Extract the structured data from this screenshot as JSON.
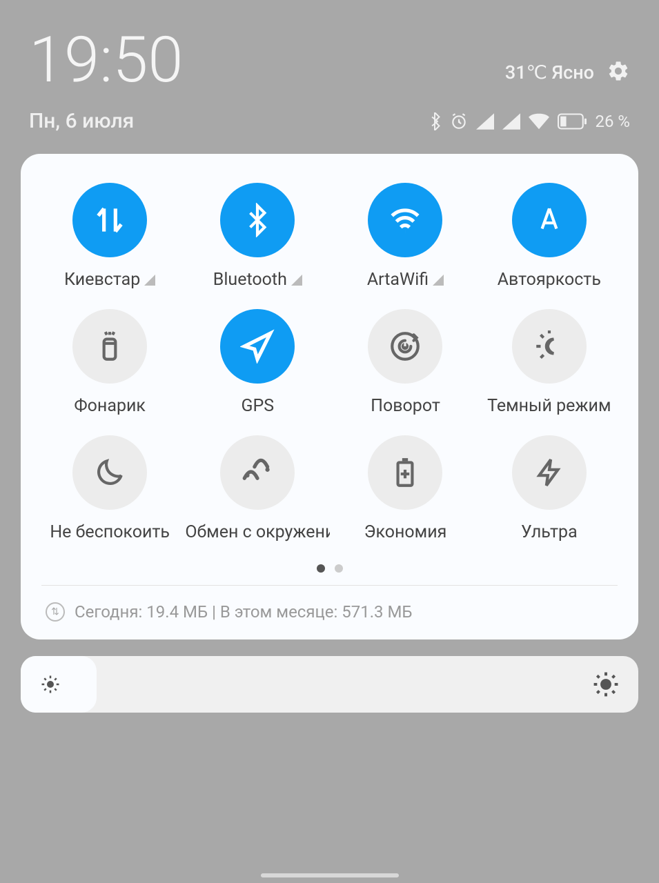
{
  "time": "19:50",
  "weather": "31℃ Ясно",
  "date": "Пн, 6 июля",
  "battery_percent": "26 %",
  "tiles": [
    {
      "label": "Киевстар",
      "on": true,
      "expandable": true,
      "icon": "data"
    },
    {
      "label": "Bluetooth",
      "on": true,
      "expandable": true,
      "icon": "bluetooth"
    },
    {
      "label": "ArtaWifi",
      "on": true,
      "expandable": true,
      "icon": "wifi"
    },
    {
      "label": "Автояркость",
      "on": true,
      "expandable": false,
      "icon": "autobright"
    },
    {
      "label": "Фонарик",
      "on": false,
      "expandable": false,
      "icon": "flashlight"
    },
    {
      "label": "GPS",
      "on": true,
      "expandable": false,
      "icon": "gps"
    },
    {
      "label": "Поворот",
      "on": false,
      "expandable": false,
      "icon": "rotate"
    },
    {
      "label": "Темный режим",
      "on": false,
      "expandable": false,
      "icon": "dark"
    },
    {
      "label": "Не беспокоить",
      "on": false,
      "expandable": false,
      "icon": "dnd"
    },
    {
      "label": "Обмен с окружением",
      "on": false,
      "expandable": false,
      "icon": "share"
    },
    {
      "label": "Экономия",
      "on": false,
      "expandable": false,
      "icon": "battery"
    },
    {
      "label": "Ультра",
      "on": false,
      "expandable": false,
      "icon": "ultra"
    }
  ],
  "data_usage": "Сегодня: 19.4 МБ | В этом месяце: 571.3 МБ",
  "colors": {
    "accent": "#0f9cf3"
  }
}
